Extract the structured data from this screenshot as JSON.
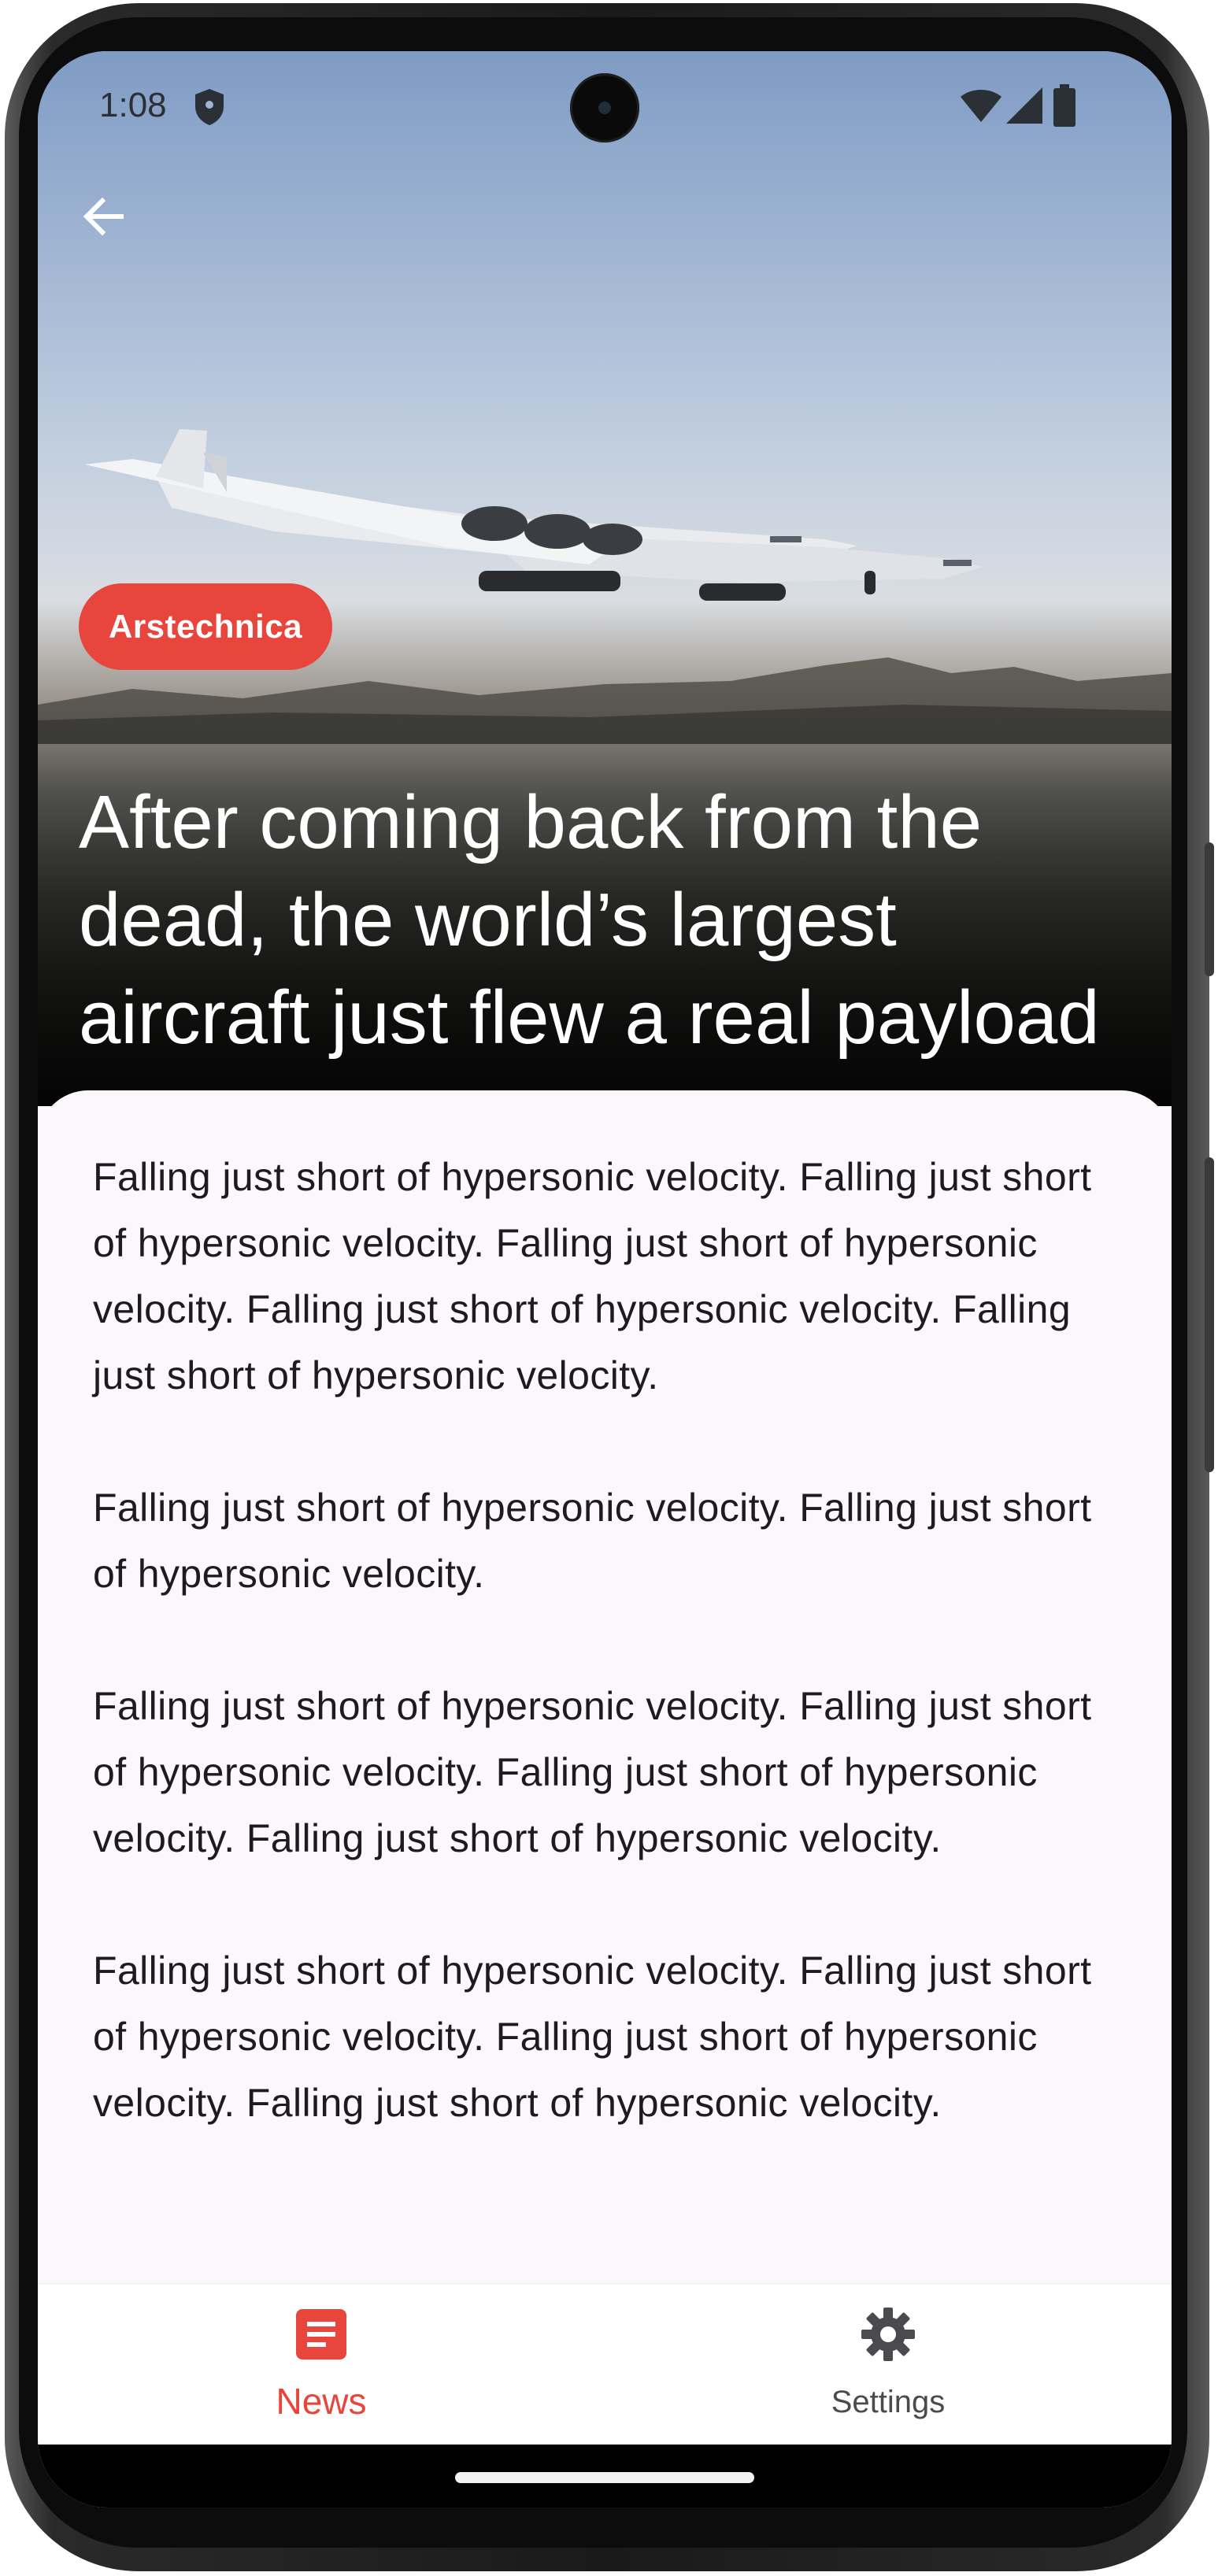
{
  "status_bar": {
    "time": "1:08"
  },
  "icons": {
    "back": "arrow-back-icon",
    "shield": "shield-icon",
    "wifi": "wifi-icon",
    "signal": "cellular-signal-icon",
    "battery": "battery-icon",
    "news": "article-icon",
    "settings": "gear-icon"
  },
  "article": {
    "source": "Arstechnica",
    "title": "After coming back from the dead, the world’s largest aircraft just flew a real payload",
    "paragraphs": [
      "Falling just short of hypersonic velocity. Falling just short of hypersonic velocity. Falling just short of hypersonic velocity. Falling just short of hypersonic velocity. Falling just short of hypersonic velocity.",
      "Falling just short of hypersonic velocity. Falling just short of hypersonic velocity.",
      "Falling just short of hypersonic velocity. Falling just short of hypersonic velocity. Falling just short of hypersonic velocity. Falling just short of hypersonic velocity.",
      "Falling just short of hypersonic velocity. Falling just short of hypersonic velocity. Falling just short of hypersonic velocity. Falling just short of hypersonic velocity."
    ]
  },
  "bottom_nav": {
    "items": [
      {
        "label": "News",
        "icon": "article-icon",
        "selected": true
      },
      {
        "label": "Settings",
        "icon": "gear-icon",
        "selected": false
      }
    ]
  },
  "colors": {
    "accent": "#e8453c",
    "background": "#fbf7fa",
    "text": "#1d1b20",
    "nav_inactive": "#4a4a4f"
  }
}
